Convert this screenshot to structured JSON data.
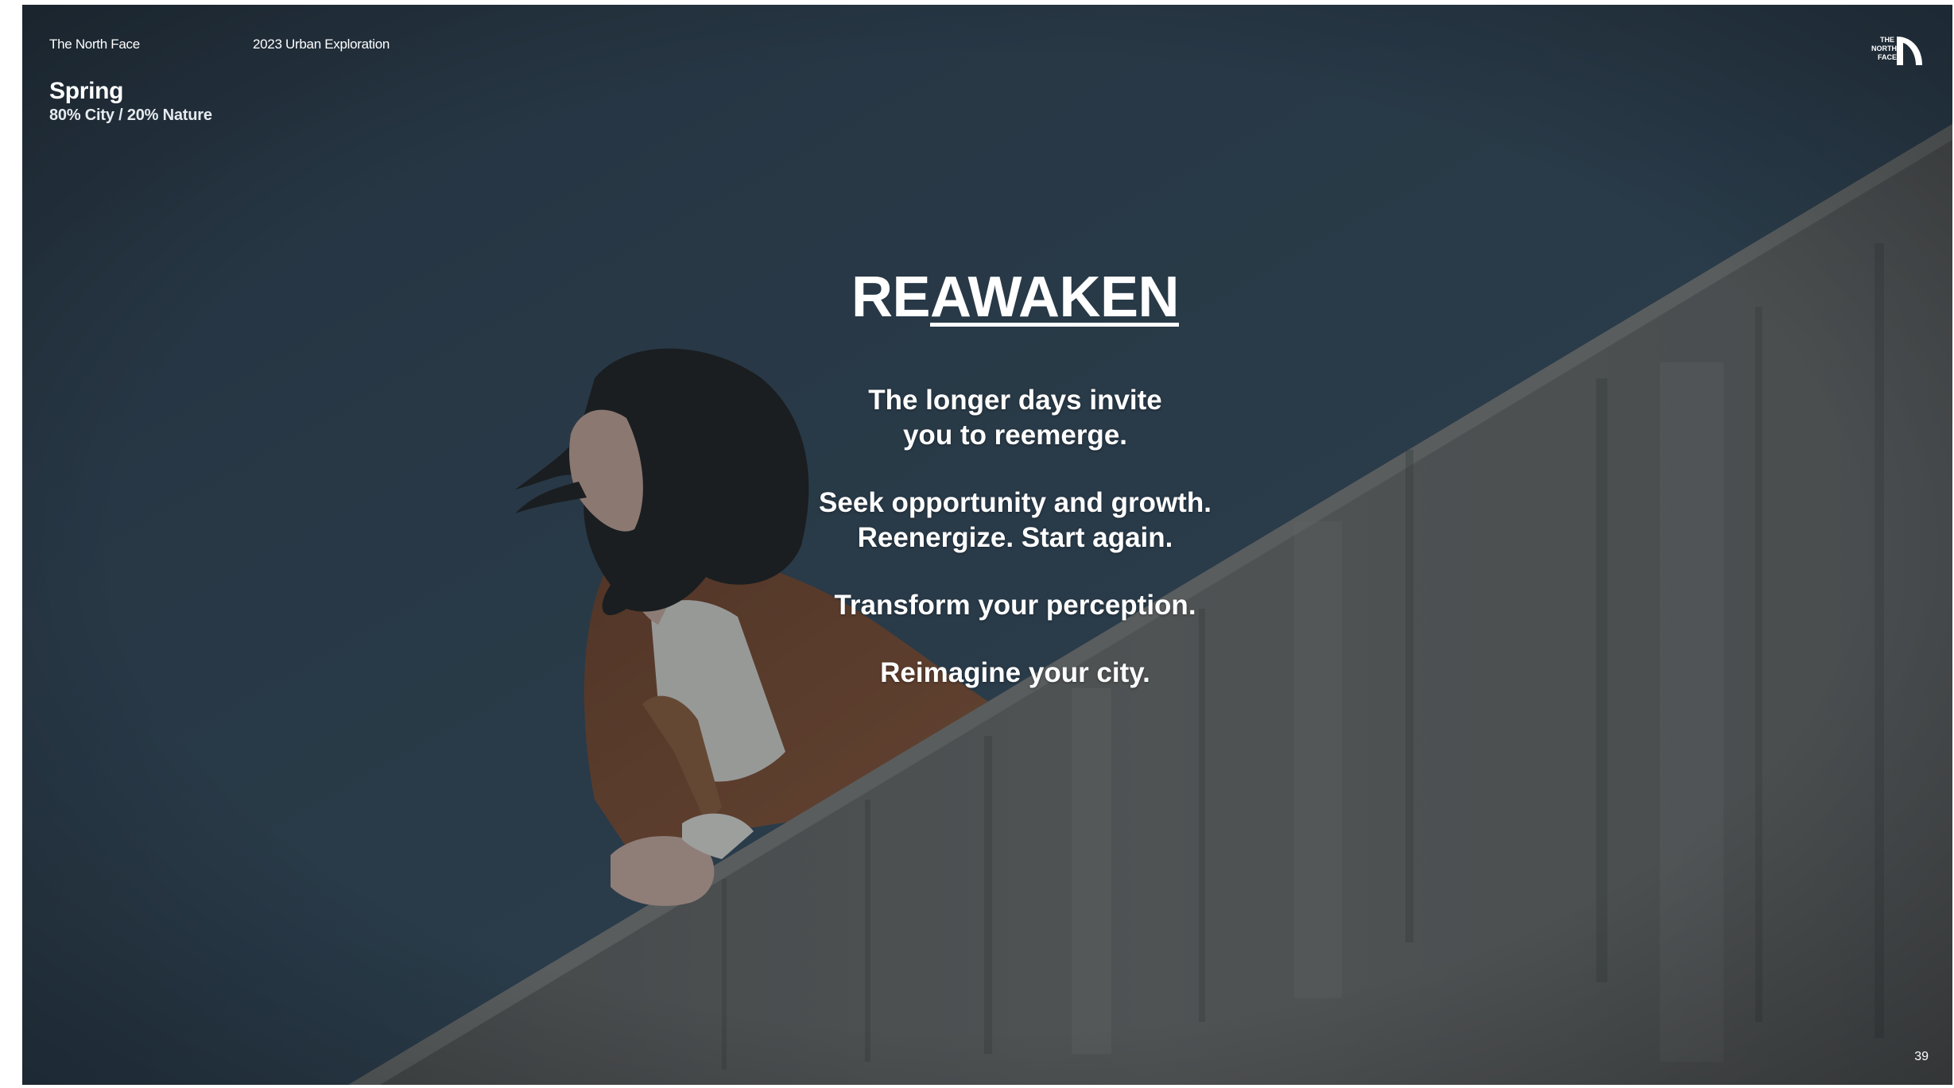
{
  "header": {
    "brand": "The North Face",
    "collection": "2023 Urban Exploration",
    "season": "Spring",
    "mix": "80% City / 20% Nature"
  },
  "logo": {
    "text_lines": [
      "THE",
      "NORTH",
      "FACE"
    ],
    "icon": "the-north-face-logo"
  },
  "headline": {
    "part1": "RE",
    "part2": "AWAKEN"
  },
  "body": {
    "p1_line1": "The longer days invite",
    "p1_line2": "you to reemerge.",
    "p2_line1": "Seek opportunity and growth.",
    "p2_line2": "Reenergize. Start again.",
    "p3": "Transform your perception.",
    "p4": "Reimagine your city."
  },
  "footer": {
    "page_number": "39"
  },
  "colors": {
    "sky": "#2b3a48",
    "wall": "#6a6863",
    "jacket": "#7b4526",
    "text": "#ffffff"
  }
}
